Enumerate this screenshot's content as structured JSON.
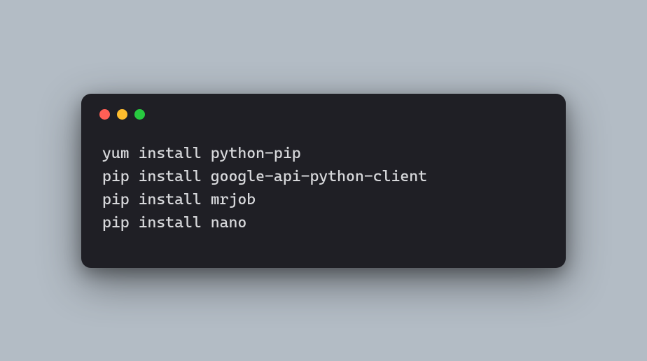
{
  "traffic_lights": {
    "close_color": "#ff5f56",
    "minimize_color": "#ffbd2e",
    "zoom_color": "#27c93f"
  },
  "terminal": {
    "lines": [
      "yum install python-pip",
      "pip install google-api-python-client",
      "pip install mrjob",
      "pip install nano"
    ]
  }
}
